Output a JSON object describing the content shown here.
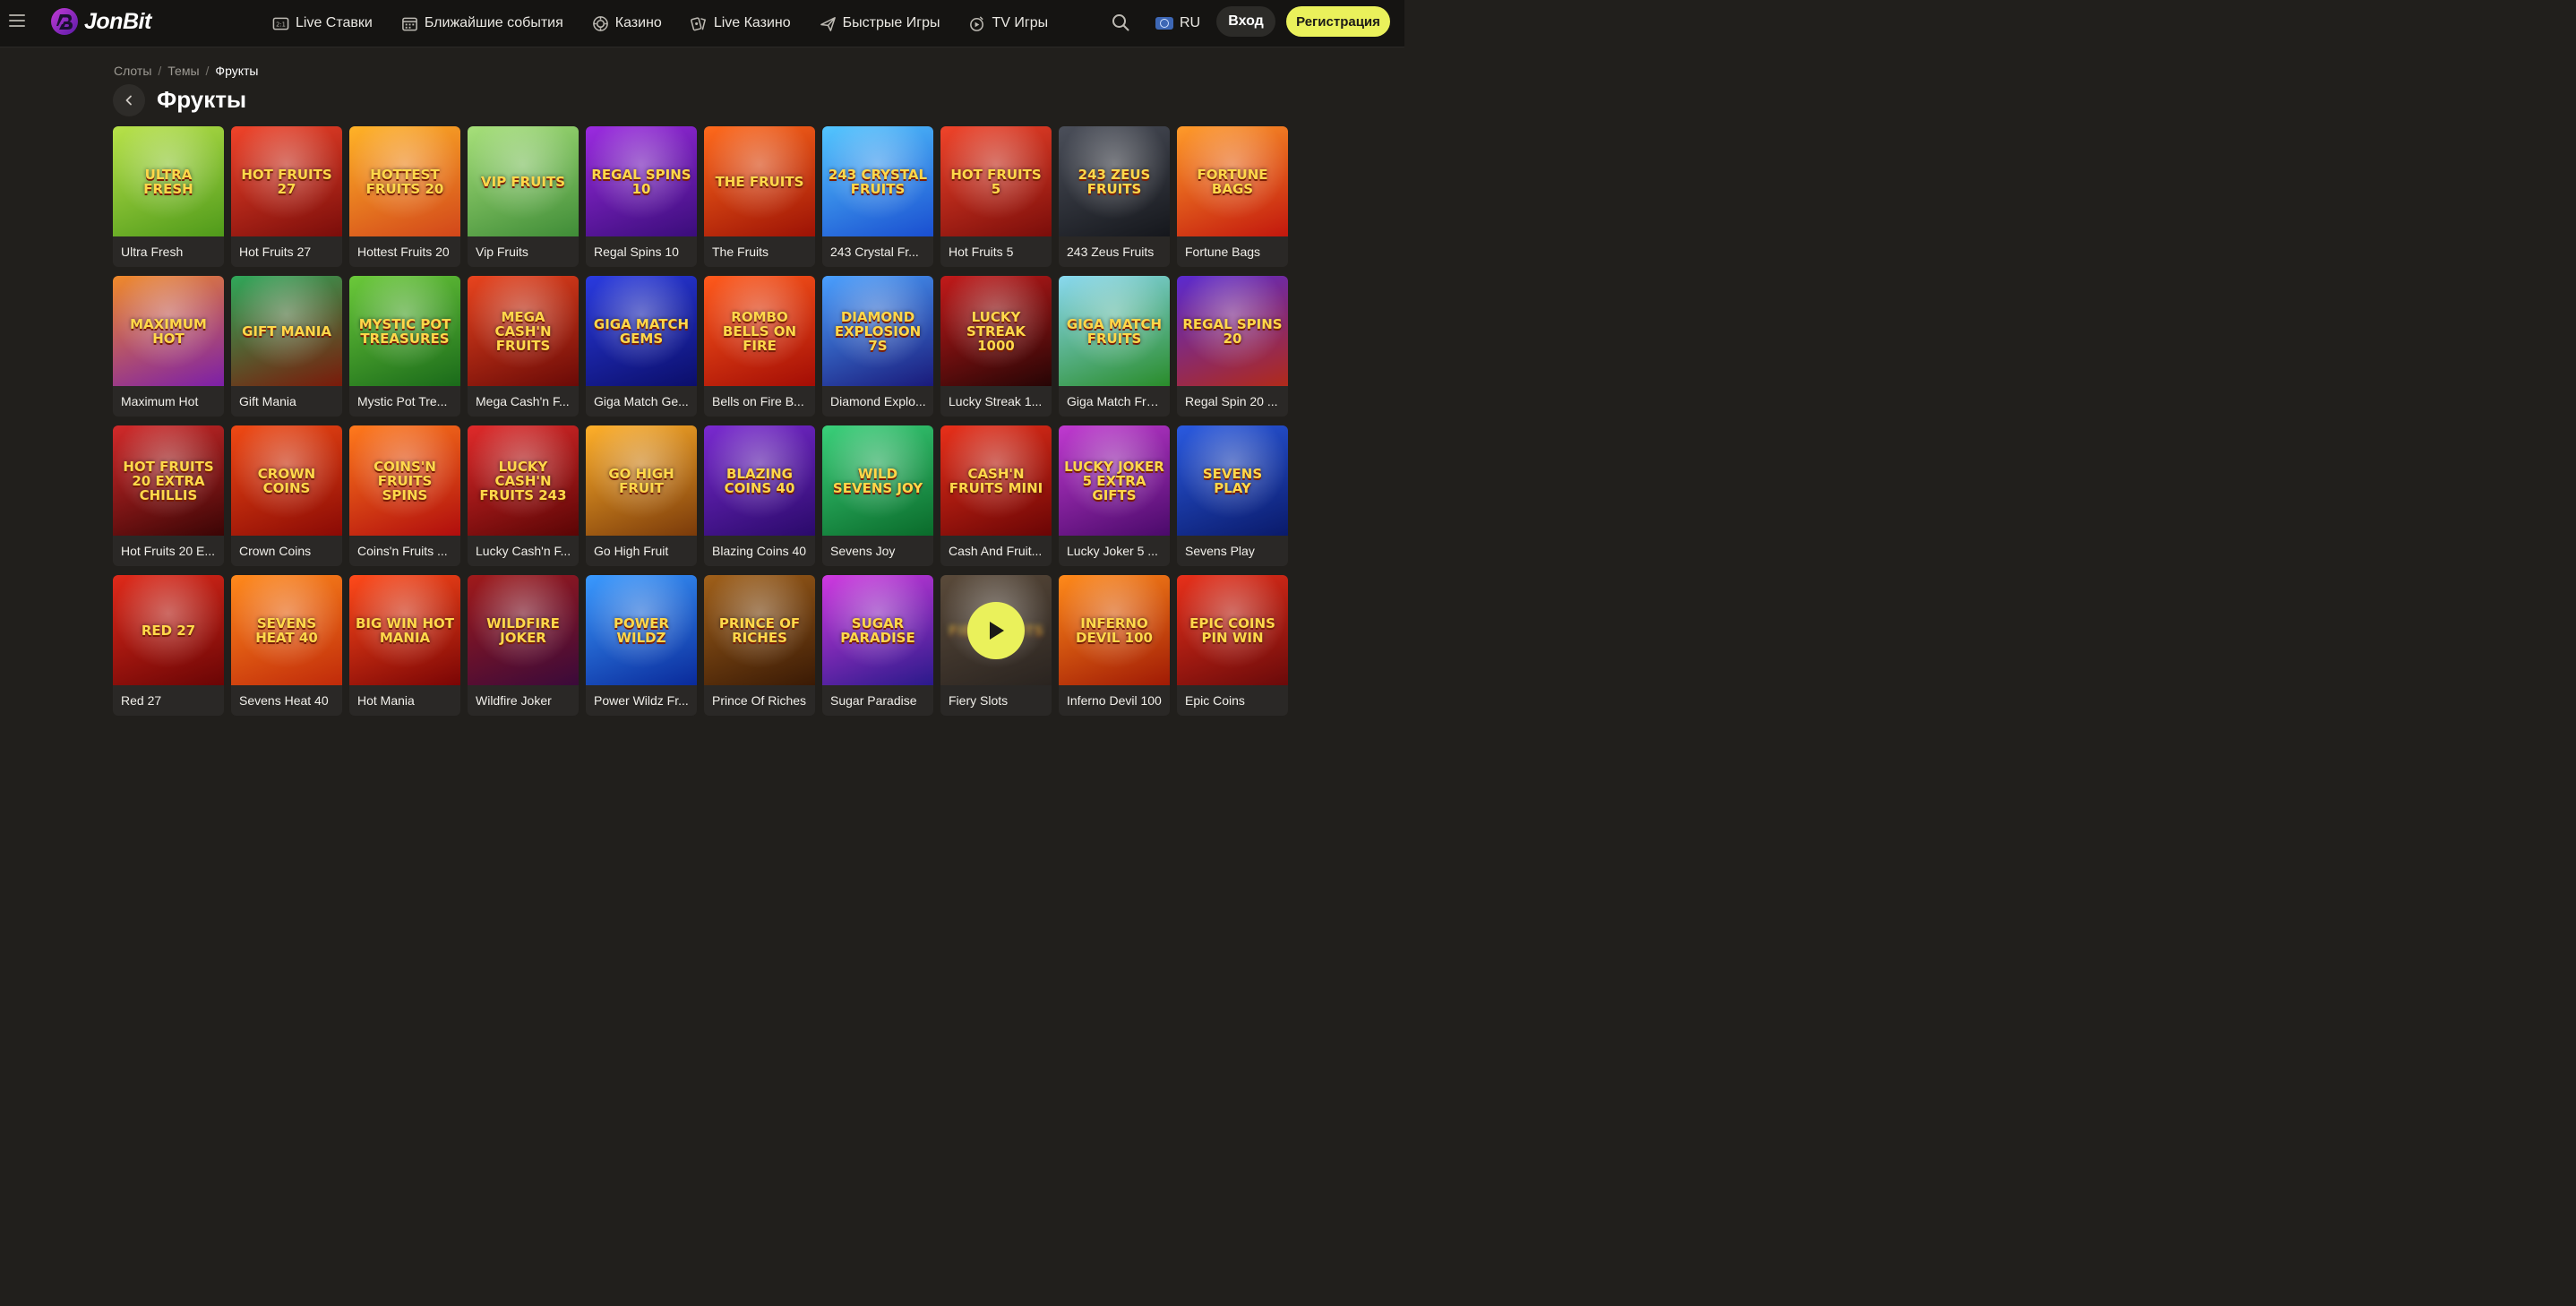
{
  "header": {
    "logo_text": "JonBit",
    "nav": [
      {
        "label": "Live Ставки",
        "icon": "live-bets-icon"
      },
      {
        "label": "Ближайшие события",
        "icon": "calendar-icon"
      },
      {
        "label": "Казино",
        "icon": "casino-chip-icon"
      },
      {
        "label": "Live Казино",
        "icon": "live-casino-icon"
      },
      {
        "label": "Быстрые Игры",
        "icon": "plane-icon"
      },
      {
        "label": "TV Игры",
        "icon": "tv-games-icon"
      }
    ],
    "language": "RU",
    "login_label": "Вход",
    "register_label": "Регистрация"
  },
  "breadcrumb": [
    "Слоты",
    "Темы",
    "Фрукты"
  ],
  "page_title": "Фрукты",
  "games": [
    {
      "name": "Ultra Fresh",
      "art": "Ultra Fresh",
      "bg": [
        "#b8e24a",
        "#4f9a1a"
      ]
    },
    {
      "name": "Hot Fruits 27",
      "art": "Hot Fruits 27",
      "bg": [
        "#f0442a",
        "#7a0d0a"
      ]
    },
    {
      "name": "Hottest Fruits 20",
      "art": "Hottest Fruits 20",
      "bg": [
        "#ffb327",
        "#d2461a"
      ]
    },
    {
      "name": "Vip Fruits",
      "art": "Vip Fruits",
      "bg": [
        "#a7e07a",
        "#3f8c37"
      ]
    },
    {
      "name": "Regal Spins 10",
      "art": "Regal Spins 10",
      "bg": [
        "#9b2be0",
        "#3a0d7a"
      ]
    },
    {
      "name": "The Fruits",
      "art": "The Fruits",
      "bg": [
        "#ff6a1c",
        "#9c1205"
      ]
    },
    {
      "name": "243 Crystal Fr...",
      "art": "243 Crystal Fruits",
      "bg": [
        "#53c6ff",
        "#1a4ed0"
      ]
    },
    {
      "name": "Hot Fruits 5",
      "art": "Hot Fruits 5",
      "bg": [
        "#f0442a",
        "#7a0d0a"
      ]
    },
    {
      "name": "243 Zeus Fruits",
      "art": "243 Zeus Fruits",
      "bg": [
        "#4b4f5a",
        "#15171c"
      ]
    },
    {
      "name": "Fortune Bags",
      "art": "Fortune Bags",
      "bg": [
        "#ff9b2a",
        "#c2170d"
      ]
    },
    {
      "name": "Maximum Hot",
      "art": "Maximum Hot",
      "bg": [
        "#f08a2a",
        "#7c1fa8"
      ]
    },
    {
      "name": "Gift Mania",
      "art": "Gift Mania",
      "bg": [
        "#2fa85a",
        "#7a1a0a"
      ]
    },
    {
      "name": "Mystic Pot Tre...",
      "art": "Mystic Pot Treasures",
      "bg": [
        "#6bc93a",
        "#1a6a1a"
      ]
    },
    {
      "name": "Mega Cash'n F...",
      "art": "Mega Cash'n Fruits",
      "bg": [
        "#e8441e",
        "#6a0a07"
      ]
    },
    {
      "name": "Giga Match Ge...",
      "art": "Giga Match Gems",
      "bg": [
        "#2a3be0",
        "#0b0e6a"
      ]
    },
    {
      "name": "Bells on Fire B...",
      "art": "Rombo Bells On Fire",
      "bg": [
        "#ff5a1c",
        "#a30d05"
      ]
    },
    {
      "name": "Diamond Explo...",
      "art": "Diamond Explosion 7s",
      "bg": [
        "#4aa0ff",
        "#1a1a7a"
      ]
    },
    {
      "name": "Lucky Streak 1...",
      "art": "Lucky Streak 1000",
      "bg": [
        "#c21a1a",
        "#260505"
      ]
    },
    {
      "name": "Giga Match Fru...",
      "art": "Giga Match Fruits",
      "bg": [
        "#8ad9f0",
        "#2a8c2a"
      ]
    },
    {
      "name": "Regal Spin 20 ...",
      "art": "Regal Spins 20",
      "bg": [
        "#5a2ad0",
        "#b02a1a"
      ]
    },
    {
      "name": "Hot Fruits 20 E...",
      "art": "Hot Fruits 20 Extra Chillis",
      "bg": [
        "#d22a2a",
        "#3a0505"
      ]
    },
    {
      "name": "Crown Coins",
      "art": "Crown Coins",
      "bg": [
        "#f04a14",
        "#8a0a05"
      ]
    },
    {
      "name": "Coins'n Fruits ...",
      "art": "Coins'n Fruits Spins",
      "bg": [
        "#ff7a1c",
        "#b00d0d"
      ]
    },
    {
      "name": "Lucky Cash'n F...",
      "art": "Lucky Cash'n Fruits 243",
      "bg": [
        "#e02a2a",
        "#5a0505"
      ]
    },
    {
      "name": "Go High Fruit",
      "art": "Go High Fruit",
      "bg": [
        "#ffb02a",
        "#7a3a0a"
      ]
    },
    {
      "name": "Blazing Coins 40",
      "art": "Blazing Coins 40",
      "bg": [
        "#7a2ad0",
        "#2a0a6a"
      ]
    },
    {
      "name": "Sevens Joy",
      "art": "Wild Sevens Joy",
      "bg": [
        "#3ad07a",
        "#0a6a2a"
      ]
    },
    {
      "name": "Cash And Fruit...",
      "art": "Cash'n Fruits Mini",
      "bg": [
        "#e8301a",
        "#6a0505"
      ]
    },
    {
      "name": "Lucky Joker 5 ...",
      "art": "Lucky Joker 5 Extra Gifts",
      "bg": [
        "#c03ad0",
        "#4a0a6a"
      ]
    },
    {
      "name": "Sevens Play",
      "art": "Sevens Play",
      "bg": [
        "#2a5ae0",
        "#0a1a6a"
      ]
    },
    {
      "name": "Red 27",
      "art": "Red 27",
      "bg": [
        "#e02a1a",
        "#6a0505"
      ]
    },
    {
      "name": "Sevens Heat 40",
      "art": "Sevens Heat 40",
      "bg": [
        "#ff8a1c",
        "#c02a0a"
      ]
    },
    {
      "name": "Hot Mania",
      "art": "Big Win Hot Mania",
      "bg": [
        "#ff4a1a",
        "#7a0505"
      ]
    },
    {
      "name": "Wildfire Joker",
      "art": "Wildfire Joker",
      "bg": [
        "#a01a1a",
        "#3a0a3a"
      ]
    },
    {
      "name": "Power Wildz Fr...",
      "art": "Power Wildz",
      "bg": [
        "#3a9aff",
        "#0a2a9a"
      ]
    },
    {
      "name": "Prince Of Riches",
      "art": "Prince Of Riches",
      "bg": [
        "#a0601a",
        "#3a1a05"
      ]
    },
    {
      "name": "Sugar Paradise",
      "art": "Sugar Paradise",
      "bg": [
        "#d03ae0",
        "#2a1a8a"
      ]
    },
    {
      "name": "Fiery Slots",
      "art": "Fiery Slots",
      "bg": [
        "#5a4a3a",
        "#2a2420"
      ],
      "hover": true
    },
    {
      "name": "Inferno Devil 100",
      "art": "Inferno Devil 100",
      "bg": [
        "#ff8a1a",
        "#a01a05"
      ]
    },
    {
      "name": "Epic Coins",
      "art": "Epic Coins Pin Win",
      "bg": [
        "#e8301a",
        "#6a0a0a"
      ]
    }
  ]
}
